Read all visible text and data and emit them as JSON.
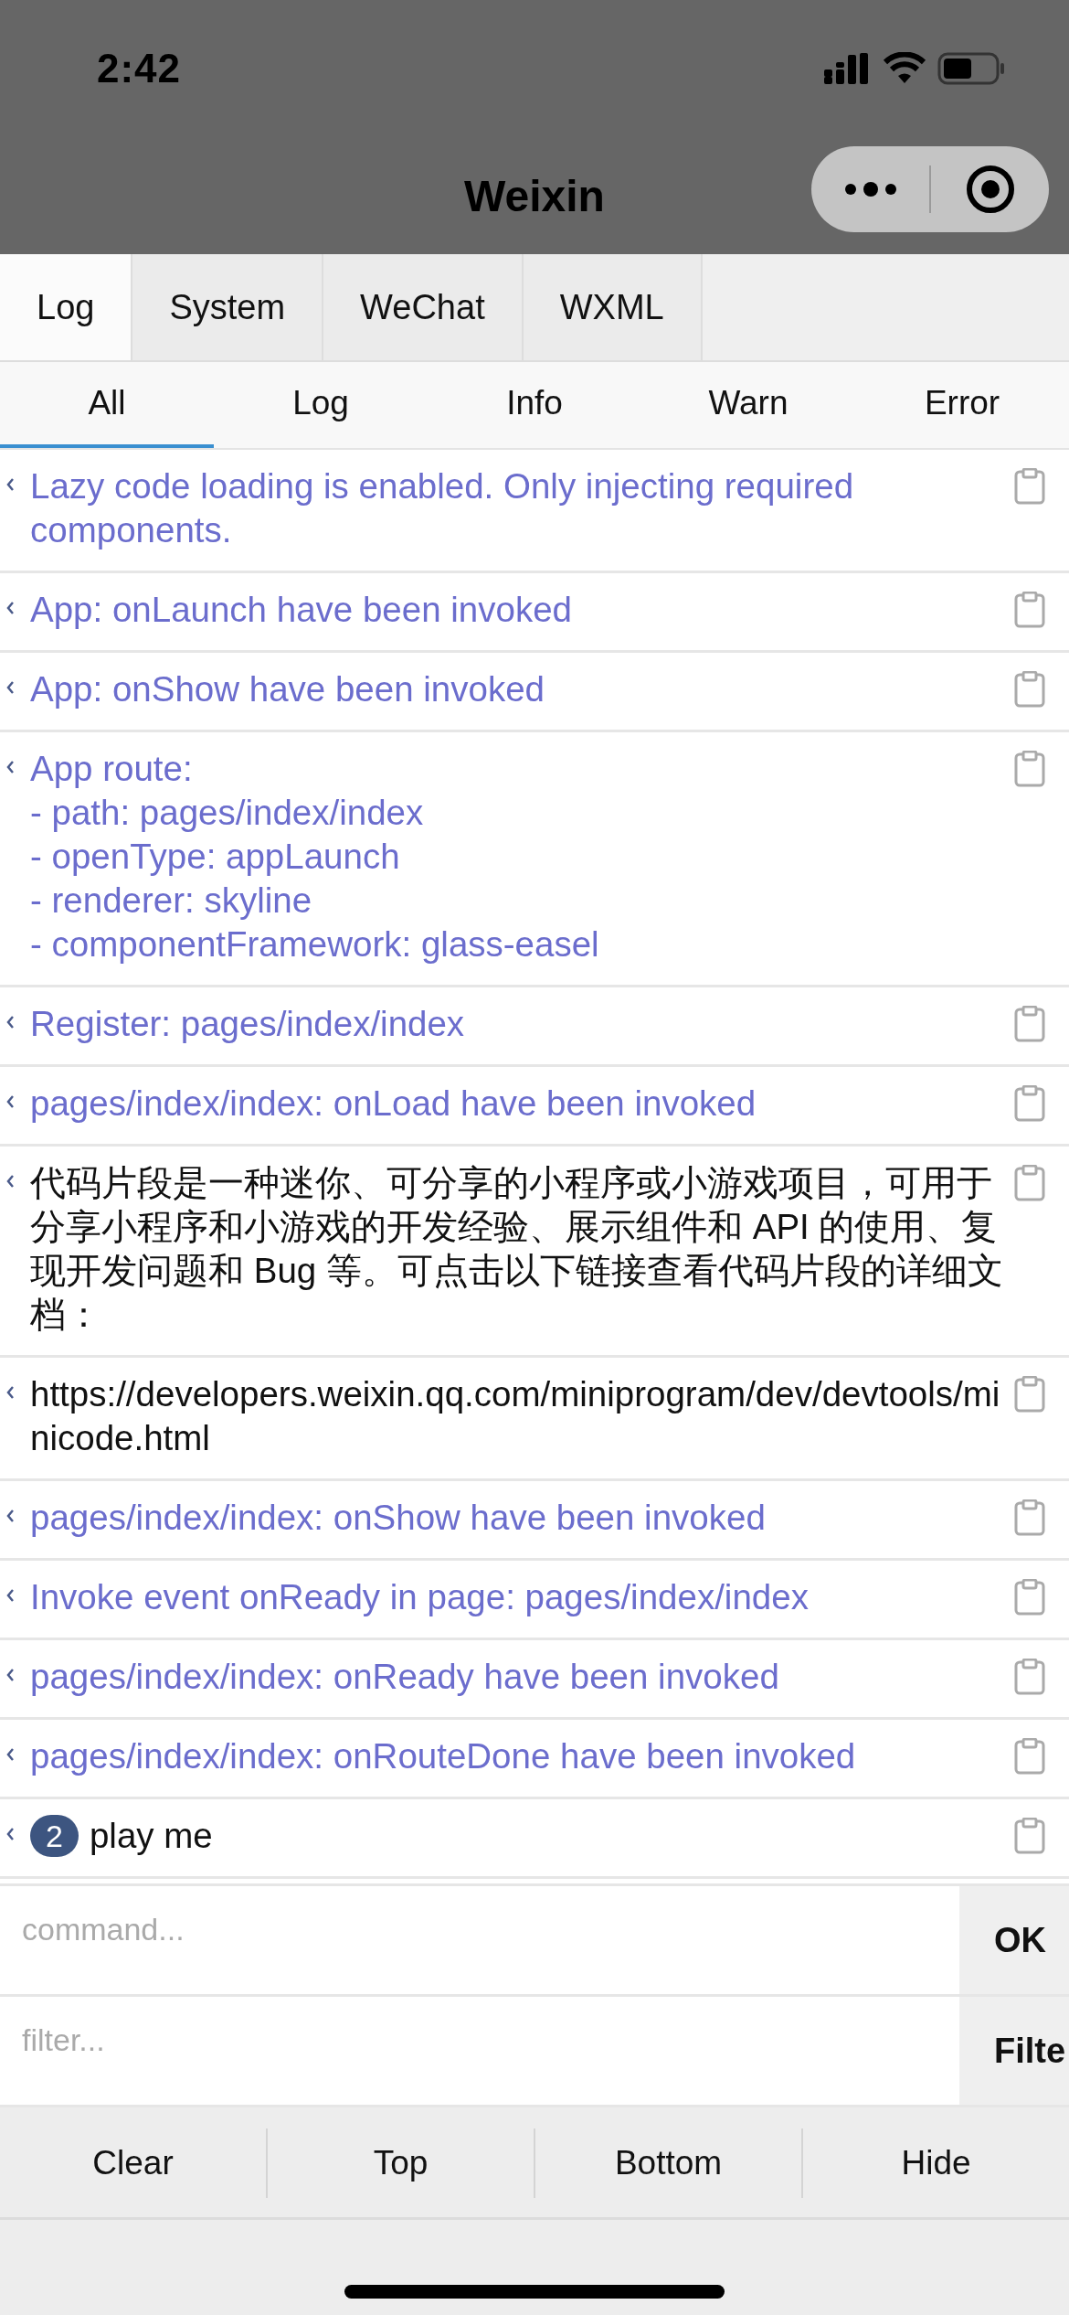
{
  "status_bar": {
    "time": "2:42"
  },
  "nav": {
    "title": "Weixin"
  },
  "tabs": [
    {
      "label": "Log",
      "selected": true
    },
    {
      "label": "System",
      "selected": false
    },
    {
      "label": "WeChat",
      "selected": false
    },
    {
      "label": "WXML",
      "selected": false
    }
  ],
  "level_filters": [
    {
      "label": "All",
      "selected": true
    },
    {
      "label": "Log",
      "selected": false
    },
    {
      "label": "Info",
      "selected": false
    },
    {
      "label": "Warn",
      "selected": false
    },
    {
      "label": "Error",
      "selected": false
    }
  ],
  "entries": [
    {
      "kind": "info",
      "text": "Lazy code loading is enabled. Only injecting required components."
    },
    {
      "kind": "info",
      "text": "App: onLaunch have been invoked"
    },
    {
      "kind": "info",
      "text": "App: onShow have been invoked"
    },
    {
      "kind": "info",
      "text": "App route:\n- path: pages/index/index\n- openType: appLaunch\n- renderer: skyline\n- componentFramework: glass-easel"
    },
    {
      "kind": "info",
      "text": "Register: pages/index/index"
    },
    {
      "kind": "info",
      "text": "pages/index/index: onLoad have been invoked"
    },
    {
      "kind": "log",
      "text": "代码片段是一种迷你、可分享的小程序或小游戏项目，可用于分享小程序和小游戏的开发经验、展示组件和 API 的使用、复现开发问题和 Bug 等。可点击以下链接查看代码片段的详细文档："
    },
    {
      "kind": "log",
      "text": "https://developers.weixin.qq.com/miniprogram/dev/devtools/minicode.html"
    },
    {
      "kind": "info",
      "text": "pages/index/index: onShow have been invoked"
    },
    {
      "kind": "info",
      "text": "Invoke event onReady in page: pages/index/index"
    },
    {
      "kind": "info",
      "text": "pages/index/index: onReady have been invoked"
    },
    {
      "kind": "info",
      "text": "pages/index/index: onRouteDone have been invoked"
    },
    {
      "kind": "log",
      "count": "2",
      "text": "play me"
    }
  ],
  "command": {
    "placeholder": "command...",
    "button": "OK"
  },
  "filter": {
    "placeholder": "filter...",
    "button": "Filte"
  },
  "toolbar": [
    "Clear",
    "Top",
    "Bottom",
    "Hide"
  ]
}
